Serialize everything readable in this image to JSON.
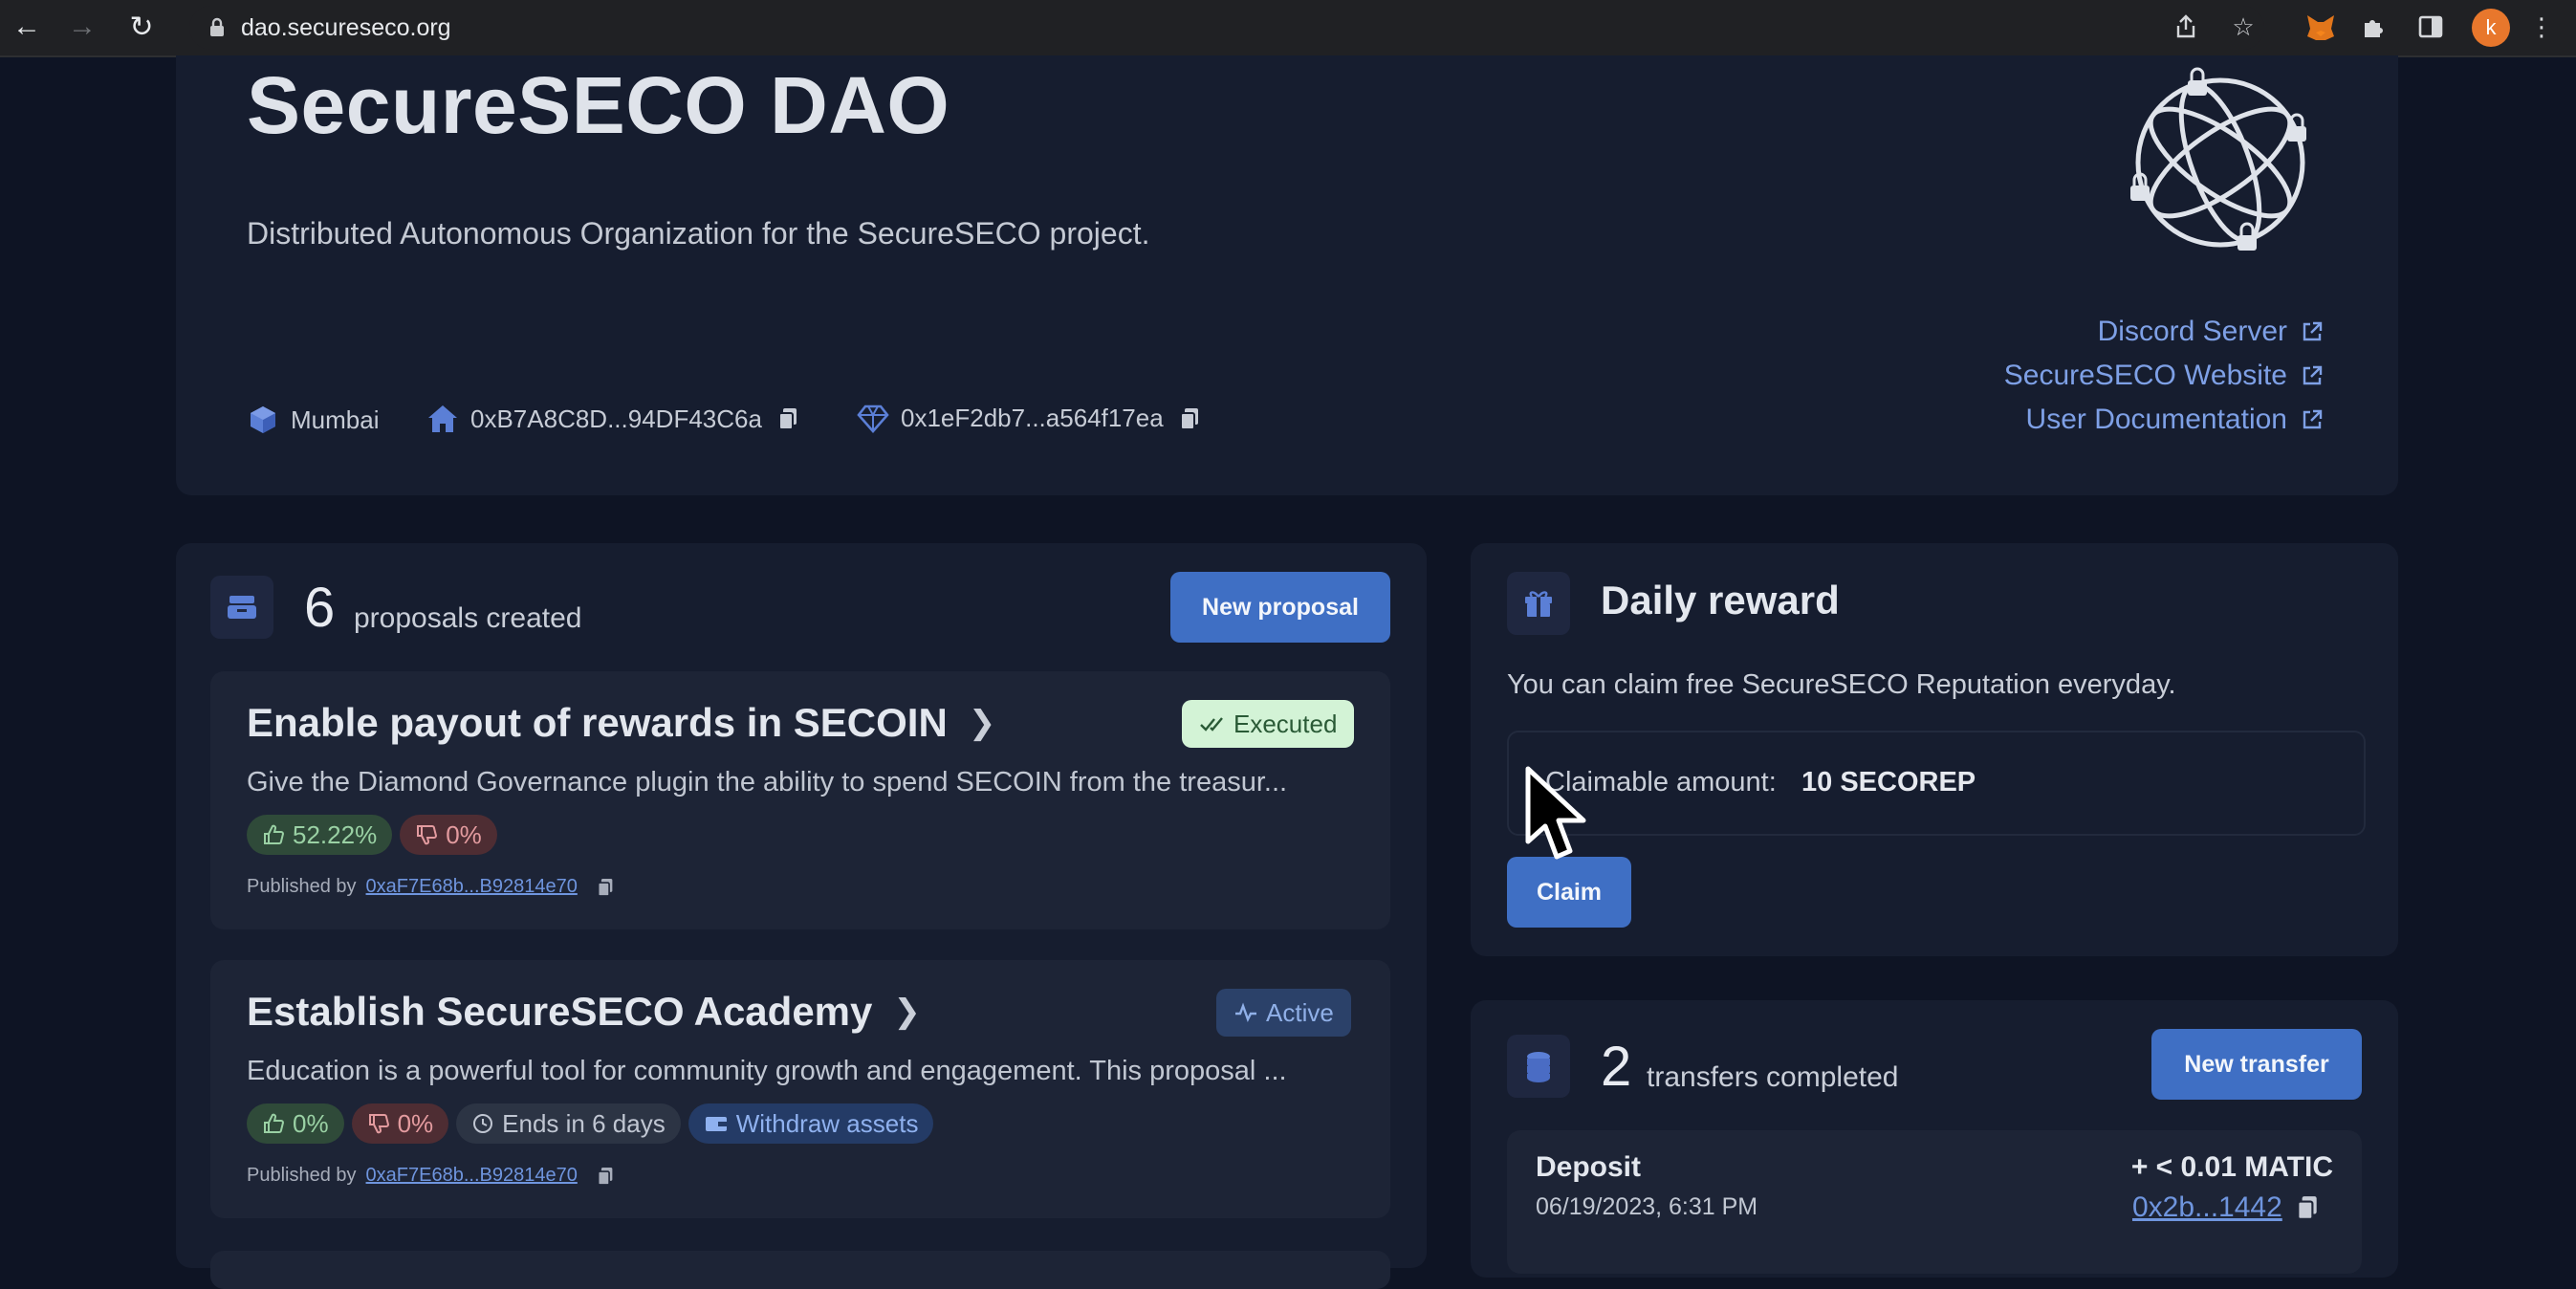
{
  "browser": {
    "url": "dao.secureseco.org",
    "profile_initial": "k"
  },
  "dao": {
    "title": "SecureSECO DAO",
    "description": "Distributed Autonomous Organization for the SecureSECO project.",
    "network": "Mumbai",
    "dao_address": "0xB7A8C8D...94DF43C6a",
    "diamond_address": "0x1eF2db7...a564f17ea",
    "links": [
      {
        "label": "Discord Server"
      },
      {
        "label": "SecureSECO Website"
      },
      {
        "label": "User Documentation"
      }
    ]
  },
  "proposals": {
    "count": "6",
    "count_label": "proposals created",
    "new_button": "New proposal",
    "published_by_label": "Published by",
    "items": [
      {
        "title": "Enable payout of rewards in SECOIN",
        "status": "Executed",
        "description": "Give the Diamond Governance plugin the ability to spend SECOIN from the treasur...",
        "yes": "52.22%",
        "no": "0%",
        "author": "0xaF7E68b...B92814e70"
      },
      {
        "title": "Establish SecureSECO Academy",
        "status": "Active",
        "description": "Education is a powerful tool for community growth and engagement. This proposal ...",
        "yes": "0%",
        "no": "0%",
        "ends": "Ends in 6 days",
        "action": "Withdraw assets",
        "author": "0xaF7E68b...B92814e70"
      }
    ]
  },
  "reward": {
    "title": "Daily reward",
    "description": "You can claim free SecureSECO Reputation everyday.",
    "claimable_label": "Claimable amount:",
    "claimable_value": "10 SECOREP",
    "claim_button": "Claim"
  },
  "transfers": {
    "count": "2",
    "count_label": "transfers completed",
    "new_button": "New transfer",
    "items": [
      {
        "type": "Deposit",
        "date": "06/19/2023, 6:31 PM",
        "amount": "+ < 0.01 MATIC",
        "address": "0x2b...1442"
      }
    ]
  },
  "colors": {
    "background": "#0e1424",
    "card": "#161d2f",
    "accent": "#3f6fc4",
    "link": "#7ea0e6",
    "executed": "#d3f3d6",
    "active": "#2b4169"
  }
}
